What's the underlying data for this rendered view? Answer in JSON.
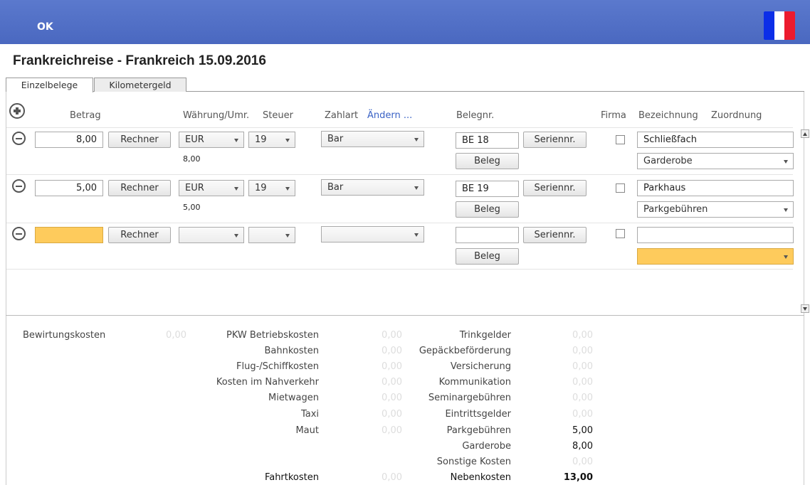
{
  "topbar": {
    "ok_label": "OK"
  },
  "flag": {
    "colors": [
      "#0b2ee8",
      "#ffffff",
      "#ec1b2e"
    ],
    "name": "france-flag"
  },
  "title": "Frankreichreise - Frankreich 15.09.2016",
  "tabs": [
    {
      "label": "Einzelbelege",
      "active": true
    },
    {
      "label": "Kilometergeld",
      "active": false
    }
  ],
  "headers": {
    "betrag": "Betrag",
    "waehrung": "Währung/Umr.",
    "steuer": "Steuer",
    "zahlart": "Zahlart",
    "aendern": "Ändern ...",
    "belegnr": "Belegnr.",
    "firma": "Firma",
    "bezeichnung": "Bezeichnung",
    "zuordnung": "Zuordnung"
  },
  "buttons": {
    "rechner": "Rechner",
    "seriennr": "Seriennr.",
    "beleg": "Beleg"
  },
  "rows": [
    {
      "betrag": "8,00",
      "currency": "EUR",
      "tax": "19",
      "converted": "8,00",
      "zahlart": "Bar",
      "belegnr": "BE 18",
      "firma": false,
      "bezeichnung": "Schließfach",
      "zuordnung": "Garderobe"
    },
    {
      "betrag": "5,00",
      "currency": "EUR",
      "tax": "19",
      "converted": "5,00",
      "zahlart": "Bar",
      "belegnr": "BE 19",
      "firma": false,
      "bezeichnung": "Parkhaus",
      "zuordnung": "Parkgebühren"
    },
    {
      "betrag": "",
      "currency": "",
      "tax": "",
      "converted": "",
      "zahlart": "",
      "belegnr": "",
      "firma": false,
      "bezeichnung": "",
      "zuordnung": ""
    }
  ],
  "summary": {
    "col1": [
      {
        "label": "Bewirtungskosten",
        "value": "0,00"
      }
    ],
    "col2": [
      {
        "label": "PKW Betriebskosten",
        "value": "0,00"
      },
      {
        "label": "Bahnkosten",
        "value": "0,00"
      },
      {
        "label": "Flug-/Schiffkosten",
        "value": "0,00"
      },
      {
        "label": "Kosten im Nahverkehr",
        "value": "0,00"
      },
      {
        "label": "Mietwagen",
        "value": "0,00"
      },
      {
        "label": "Taxi",
        "value": "0,00"
      },
      {
        "label": "Maut",
        "value": "0,00"
      }
    ],
    "col2_total": {
      "label": "Fahrtkosten",
      "value": "0,00"
    },
    "col3": [
      {
        "label": "Trinkgelder",
        "value": "0,00"
      },
      {
        "label": "Gepäckbeförderung",
        "value": "0,00"
      },
      {
        "label": "Versicherung",
        "value": "0,00"
      },
      {
        "label": "Kommunikation",
        "value": "0,00"
      },
      {
        "label": "Seminargebühren",
        "value": "0,00"
      },
      {
        "label": "Eintrittsgelder",
        "value": "0,00"
      },
      {
        "label": "Parkgebühren",
        "value": "5,00"
      },
      {
        "label": "Garderobe",
        "value": "8,00"
      },
      {
        "label": "Sonstige Kosten",
        "value": "0,00"
      }
    ],
    "col3_total": {
      "label": "Nebenkosten",
      "value": "13,00"
    }
  }
}
